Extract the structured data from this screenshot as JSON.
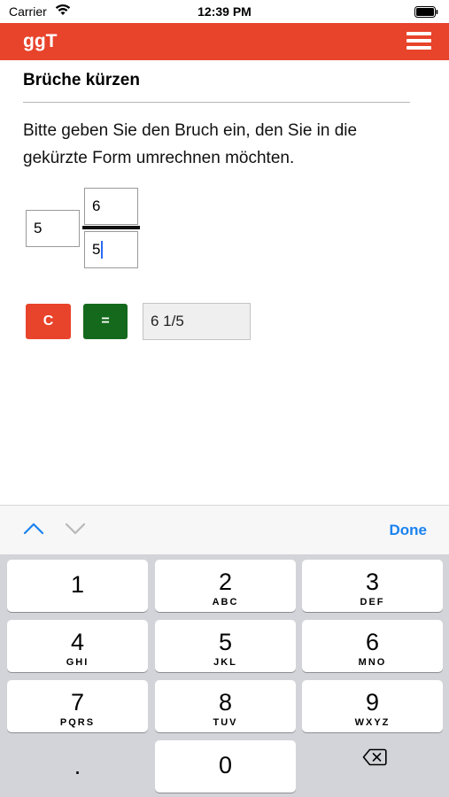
{
  "status_bar": {
    "carrier": "Carrier",
    "time": "12:39 PM"
  },
  "app_bar": {
    "title": "ggT",
    "brand_color": "#e8432b"
  },
  "content": {
    "section_title": "Brüche kürzen",
    "instruction": "Bitte geben Sie den Bruch ein, den Sie in die gekürzte Form umrechnen möchten.",
    "whole_value": "5",
    "numerator_value": "6",
    "denominator_value": "5",
    "clear_label": "C",
    "equals_label": "=",
    "result_value": "6 1/5"
  },
  "accessory": {
    "done_label": "Done"
  },
  "keypad": {
    "keys": [
      {
        "digit": "1",
        "letters": ""
      },
      {
        "digit": "2",
        "letters": "ABC"
      },
      {
        "digit": "3",
        "letters": "DEF"
      },
      {
        "digit": "4",
        "letters": "GHI"
      },
      {
        "digit": "5",
        "letters": "JKL"
      },
      {
        "digit": "6",
        "letters": "MNO"
      },
      {
        "digit": "7",
        "letters": "PQRS"
      },
      {
        "digit": "8",
        "letters": "TUV"
      },
      {
        "digit": "9",
        "letters": "WXYZ"
      }
    ],
    "dot_label": ".",
    "zero_label": "0"
  }
}
